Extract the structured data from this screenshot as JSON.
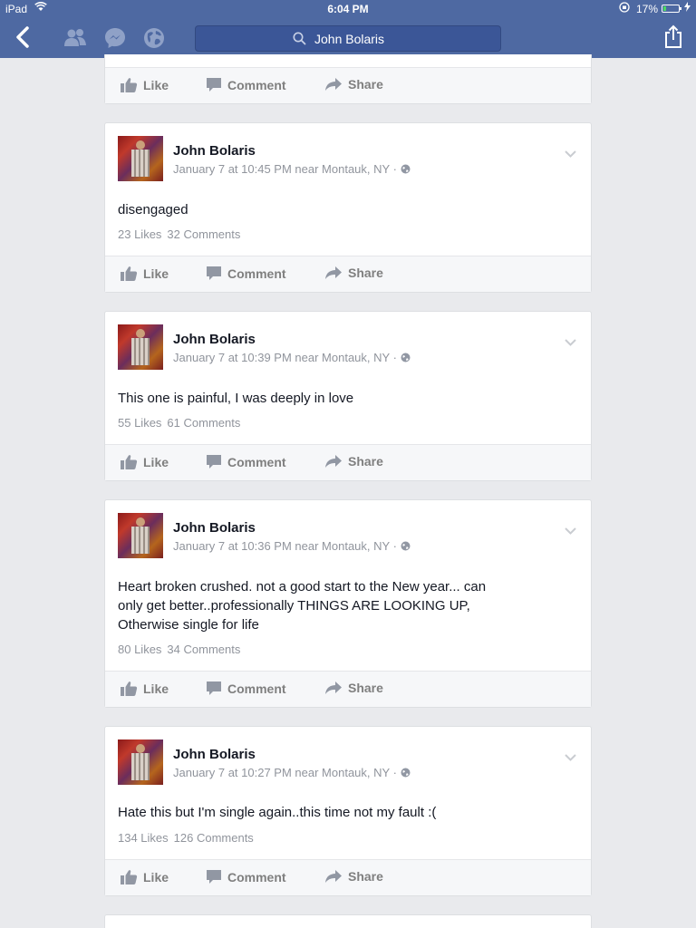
{
  "status_bar": {
    "device": "iPad",
    "time": "6:04 PM",
    "battery_percent": "17%",
    "battery_level": 0.17
  },
  "nav": {
    "search_value": "John Bolaris"
  },
  "actions": {
    "like": "Like",
    "comment": "Comment",
    "share": "Share"
  },
  "posts": [
    {
      "author": "John Bolaris",
      "meta": "January 7 at 10:45 PM near Montauk, NY ·",
      "text": "disengaged",
      "likes": "23 Likes",
      "comments": "32 Comments"
    },
    {
      "author": "John Bolaris",
      "meta": "January 7 at 10:39 PM near Montauk, NY ·",
      "text": "This one is painful, I was deeply in love",
      "likes": "55 Likes",
      "comments": "61 Comments"
    },
    {
      "author": "John Bolaris",
      "meta": "January 7 at 10:36 PM near Montauk, NY ·",
      "text_lines": [
        "Heart broken crushed. not a good start to the New year... can",
        "only get better..professionally  THINGS ARE LOOKING UP,",
        "Otherwise single for life"
      ],
      "likes": "80 Likes",
      "comments": "34 Comments"
    },
    {
      "author": "John Bolaris",
      "meta": "January 7 at 10:27 PM near Montauk, NY ·",
      "text": "Hate this but I'm single again..this time not my fault :(",
      "likes": "134 Likes",
      "comments": "126 Comments"
    }
  ],
  "colors": {
    "nav_blue": "#4e69a2",
    "background": "#e9eaed",
    "meta_gray": "#90949c",
    "action_gray": "#7f7f7f"
  }
}
